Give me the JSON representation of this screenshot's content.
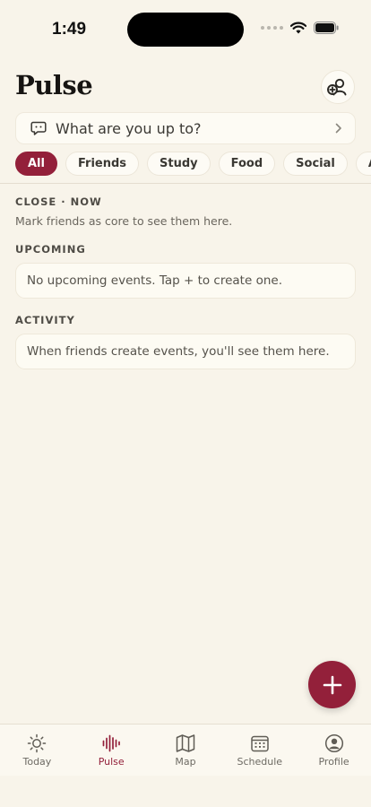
{
  "status_bar": {
    "time": "1:49"
  },
  "header": {
    "title": "Pulse"
  },
  "status_prompt": {
    "placeholder": "What are you up to?"
  },
  "chips": [
    "All",
    "Friends",
    "Study",
    "Food",
    "Social",
    "Athletics"
  ],
  "active_chip": "All",
  "sections": {
    "close": {
      "label": "CLOSE · NOW",
      "helper": "Mark friends as core to see them here."
    },
    "upcoming": {
      "label": "UPCOMING",
      "empty": "No upcoming events. Tap + to create one."
    },
    "activity": {
      "label": "ACTIVITY",
      "empty": "When friends create events, you'll see them here."
    }
  },
  "tabs": [
    {
      "label": "Today",
      "icon": "sun-icon"
    },
    {
      "label": "Pulse",
      "icon": "pulse-icon",
      "active": true
    },
    {
      "label": "Map",
      "icon": "map-icon"
    },
    {
      "label": "Schedule",
      "icon": "calendar-icon"
    },
    {
      "label": "Profile",
      "icon": "profile-icon"
    }
  ],
  "colors": {
    "accent": "#93203a",
    "background": "#f8f4ea"
  }
}
